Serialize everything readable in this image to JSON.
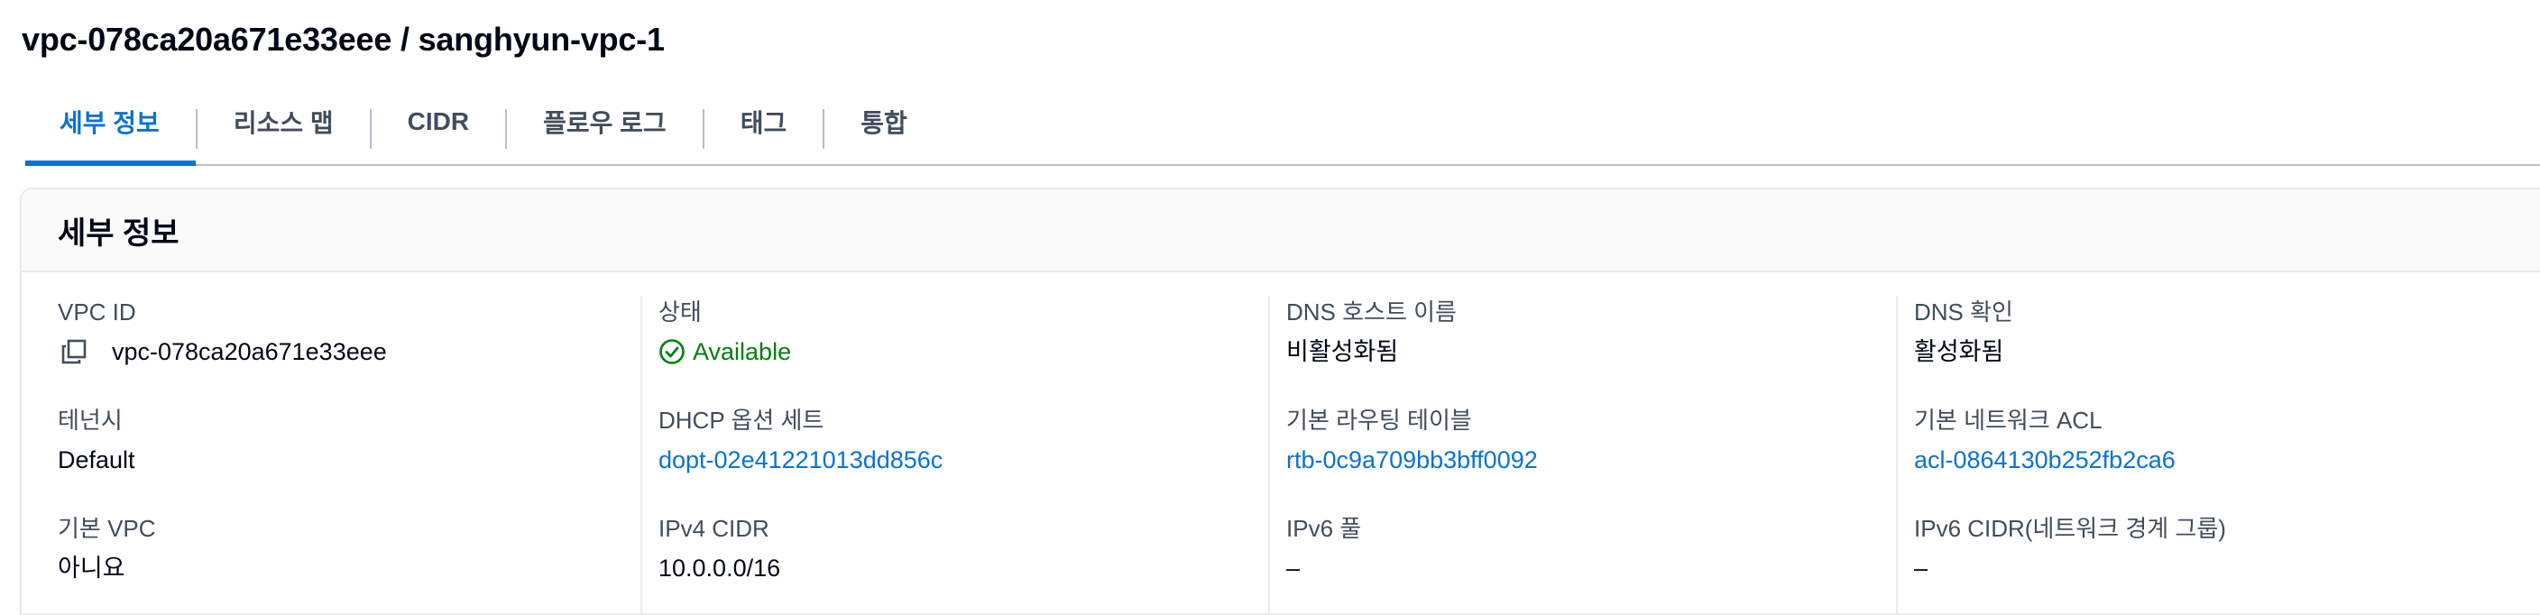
{
  "page": {
    "title": "vpc-078ca20a671e33eee / sanghyun-vpc-1"
  },
  "tabs": [
    {
      "label": "세부 정보",
      "active": true
    },
    {
      "label": "리소스 맵",
      "active": false
    },
    {
      "label": "CIDR",
      "active": false
    },
    {
      "label": "플로우 로그",
      "active": false
    },
    {
      "label": "태그",
      "active": false
    },
    {
      "label": "통합",
      "active": false
    }
  ],
  "details": {
    "title": "세부 정보",
    "vpc_id": {
      "label": "VPC ID",
      "value": "vpc-078ca20a671e33eee",
      "icon": "copy-icon"
    },
    "tenancy": {
      "label": "테넌시",
      "value": "Default"
    },
    "default_vpc": {
      "label": "기본 VPC",
      "value": "아니요"
    },
    "state": {
      "label": "상태",
      "value": "Available",
      "icon": "check-circle-icon",
      "color": "#037f0c"
    },
    "dhcp": {
      "label": "DHCP 옵션 세트",
      "value": "dopt-02e41221013dd856c"
    },
    "ipv4_cidr": {
      "label": "IPv4 CIDR",
      "value": "10.0.0.0/16"
    },
    "dns_hostnames": {
      "label": "DNS 호스트 이름",
      "value": "비활성화됨"
    },
    "main_route_table": {
      "label": "기본 라우팅 테이블",
      "value": "rtb-0c9a709bb3bff0092"
    },
    "ipv6_pool": {
      "label": "IPv6 풀",
      "value": "–"
    },
    "dns_resolution": {
      "label": "DNS 확인",
      "value": "활성화됨"
    },
    "main_network_acl": {
      "label": "기본 네트워크 ACL",
      "value": "acl-0864130b252fb2ca6"
    },
    "ipv6_cidr": {
      "label": "IPv6 CIDR(네트워크 경계 그룹)",
      "value": "–"
    }
  },
  "colors": {
    "link": "#0972d3",
    "success": "#037f0c",
    "text": "#000716",
    "label": "#414d5c"
  }
}
